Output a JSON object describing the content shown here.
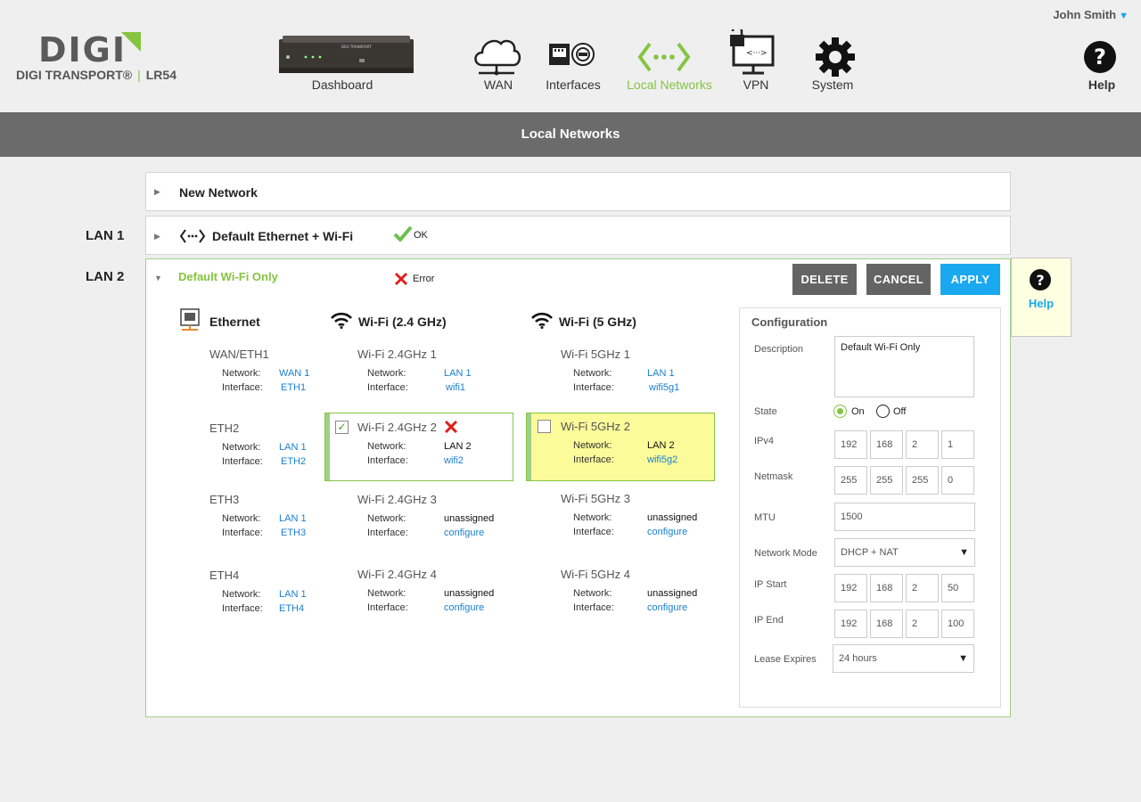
{
  "header": {
    "user": "John Smith",
    "logo_text": "DIGI",
    "product_brand": "DIGI TRANSPORT®",
    "product_model": "LR54",
    "device_label": "DIGI TRANSPORT",
    "nav": [
      {
        "label": "Dashboard",
        "icon": "router-device-icon",
        "active": false
      },
      {
        "label": "WAN",
        "icon": "cloud-icon",
        "active": false
      },
      {
        "label": "Interfaces",
        "icon": "interfaces-icon",
        "active": false
      },
      {
        "label": "Local Networks",
        "icon": "local-networks-icon",
        "active": true
      },
      {
        "label": "VPN",
        "icon": "vpn-icon",
        "active": false
      },
      {
        "label": "System",
        "icon": "gear-icon",
        "active": false
      },
      {
        "label": "Help",
        "icon": "help-icon",
        "active": false
      }
    ]
  },
  "title": "Local Networks",
  "new_network": {
    "title": "New Network"
  },
  "lan1": {
    "label": "LAN 1",
    "title": "Default Ethernet + Wi-Fi",
    "status": "OK"
  },
  "lan2": {
    "label": "LAN 2",
    "title": "Default Wi-Fi Only",
    "status": "Error",
    "buttons": {
      "delete": "DELETE",
      "cancel": "CANCEL",
      "apply": "APPLY"
    },
    "columns": {
      "ethernet": "Ethernet",
      "wifi24": "Wi-Fi (2.4 GHz)",
      "wifi5": "Wi-Fi (5 GHz)"
    },
    "kv_labels": {
      "network": "Network:",
      "interface": "Interface:"
    },
    "ethernet": [
      {
        "name": "WAN/ETH1",
        "network": "WAN 1",
        "interface": "ETH1"
      },
      {
        "name": "ETH2",
        "network": "LAN 1",
        "interface": "ETH2"
      },
      {
        "name": "ETH3",
        "network": "LAN 1",
        "interface": "ETH3"
      },
      {
        "name": "ETH4",
        "network": "LAN 1",
        "interface": "ETH4"
      }
    ],
    "wifi24": [
      {
        "name": "Wi-Fi 2.4GHz 1",
        "network": "LAN 1",
        "interface": "wifi1"
      },
      {
        "name": "Wi-Fi 2.4GHz 2",
        "network": "LAN 2",
        "interface": "wifi2",
        "checked": true
      },
      {
        "name": "Wi-Fi 2.4GHz  3",
        "network": "unassigned",
        "interface": "configure"
      },
      {
        "name": "Wi-Fi 2.4GHz  4",
        "network": "unassigned",
        "interface": "configure"
      }
    ],
    "wifi5": [
      {
        "name": "Wi-Fi 5GHz 1",
        "network": "LAN 1",
        "interface": "wifi5g1"
      },
      {
        "name": "Wi-Fi 5GHz 2",
        "network": "LAN 2",
        "interface": "wifi5g2",
        "checked": false
      },
      {
        "name": "Wi-Fi 5GHz  3",
        "network": "unassigned",
        "interface": "configure"
      },
      {
        "name": "Wi-Fi 5GHz  4",
        "network": "unassigned",
        "interface": "configure"
      }
    ]
  },
  "config": {
    "title": "Configuration",
    "description_label": "Description",
    "description_value": "Default Wi-Fi Only",
    "state_label": "State",
    "state_on": "On",
    "state_off": "Off",
    "state_value": "On",
    "ipv4_label": "IPv4",
    "ipv4": [
      "192",
      "168",
      "2",
      "1"
    ],
    "netmask_label": "Netmask",
    "netmask": [
      "255",
      "255",
      "255",
      "0"
    ],
    "mtu_label": "MTU",
    "mtu": "1500",
    "network_mode_label": "Network Mode",
    "network_mode": "DHCP + NAT",
    "ip_start_label": "IP Start",
    "ip_start": [
      "192",
      "168",
      "2",
      "50"
    ],
    "ip_end_label": "IP End",
    "ip_end": [
      "192",
      "168",
      "2",
      "100"
    ],
    "lease_label": "Lease Expires",
    "lease": "24 hours"
  },
  "help_panel": {
    "label": "Help"
  },
  "colors": {
    "accent_green": "#85c441",
    "accent_blue": "#1aa9f0",
    "title_bar": "#6b6b6b",
    "highlight_yellow": "#fbfb9a"
  }
}
